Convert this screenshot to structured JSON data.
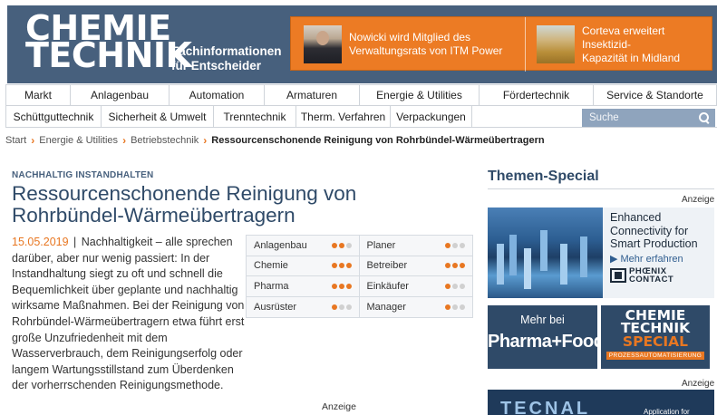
{
  "header": {
    "logo_line1": "CHEMIE",
    "logo_line2": "TECHNIK",
    "tagline_line1": "Fachinformationen",
    "tagline_line2": "für Entscheider",
    "promos": [
      {
        "line1": "Nowicki wird Mitglied des",
        "line2": "Verwaltungsrats von ITM Power"
      },
      {
        "line1": "Corteva erweitert Insektizid-",
        "line2": "Kapazität in Midland"
      }
    ]
  },
  "nav": {
    "row1": [
      "Markt",
      "Anlagenbau",
      "Automation",
      "Armaturen",
      "Energie & Utilities",
      "Fördertechnik",
      "Service & Standorte"
    ],
    "row2": [
      "Schüttguttechnik",
      "Sicherheit & Umwelt",
      "Trenntechnik",
      "Therm. Verfahren",
      "Verpackungen"
    ],
    "search_placeholder": "Suche"
  },
  "breadcrumb": [
    "Start",
    "Energie & Utilities",
    "Betriebstechnik",
    "Ressourcenschonende Reinigung von Rohrbündel-Wärmeübertragern"
  ],
  "article": {
    "kicker": "NACHHALTIG INSTANDHALTEN",
    "title_line1": "Ressourcenschonende Reinigung von",
    "title_line2": "Rohrbündel-Wärmeübertragern",
    "date": "15.05.2019",
    "separator": "|",
    "text": "Nachhaltigkeit – alle sprechen darüber, aber nur wenig passiert: In der Instandhaltung siegt zu oft und schnell die Bequemlichkeit über geplante und nachhaltig wirksame Maßnahmen. Bei der Reinigung von Rohrbündel-Wärmeübertragern etwa führt erst große Unzufriedenheit mit dem Wasserverbrauch, dem Reinigungserfolg oder langem Wartungsstillstand zum Überdenken der vorherrschenden Reinigungsmethode."
  },
  "relevance": [
    [
      {
        "label": "Anlagenbau",
        "level": 2
      },
      {
        "label": "Planer",
        "level": 1
      }
    ],
    [
      {
        "label": "Chemie",
        "level": 3
      },
      {
        "label": "Betreiber",
        "level": 3
      }
    ],
    [
      {
        "label": "Pharma",
        "level": 3
      },
      {
        "label": "Einkäufer",
        "level": 1
      }
    ],
    [
      {
        "label": "Ausrüster",
        "level": 1
      },
      {
        "label": "Manager",
        "level": 1
      }
    ]
  ],
  "ad_label": "Anzeige",
  "sidebar": {
    "title": "Themen-Special",
    "phoenix": {
      "line1": "Enhanced",
      "line2": "Connectivity for",
      "line3": "Smart Production",
      "cta": "▶ Mehr erfahren",
      "brand1": "PHŒNIX",
      "brand2": "CONTACT"
    },
    "pharma": {
      "line1": "Mehr bei",
      "line2": "Pharma+Food"
    },
    "special": {
      "line1": "CHEMIE",
      "line2": "TECHNIK",
      "line3": "SPECIAL",
      "line4": "PROZESSAUTOMATISIERUNG"
    },
    "tecnal": {
      "word": "TECNAL",
      "tag": "Application for"
    }
  },
  "colors": {
    "brand": "#47607d",
    "accent": "#e87722",
    "title": "#2f4a68"
  }
}
